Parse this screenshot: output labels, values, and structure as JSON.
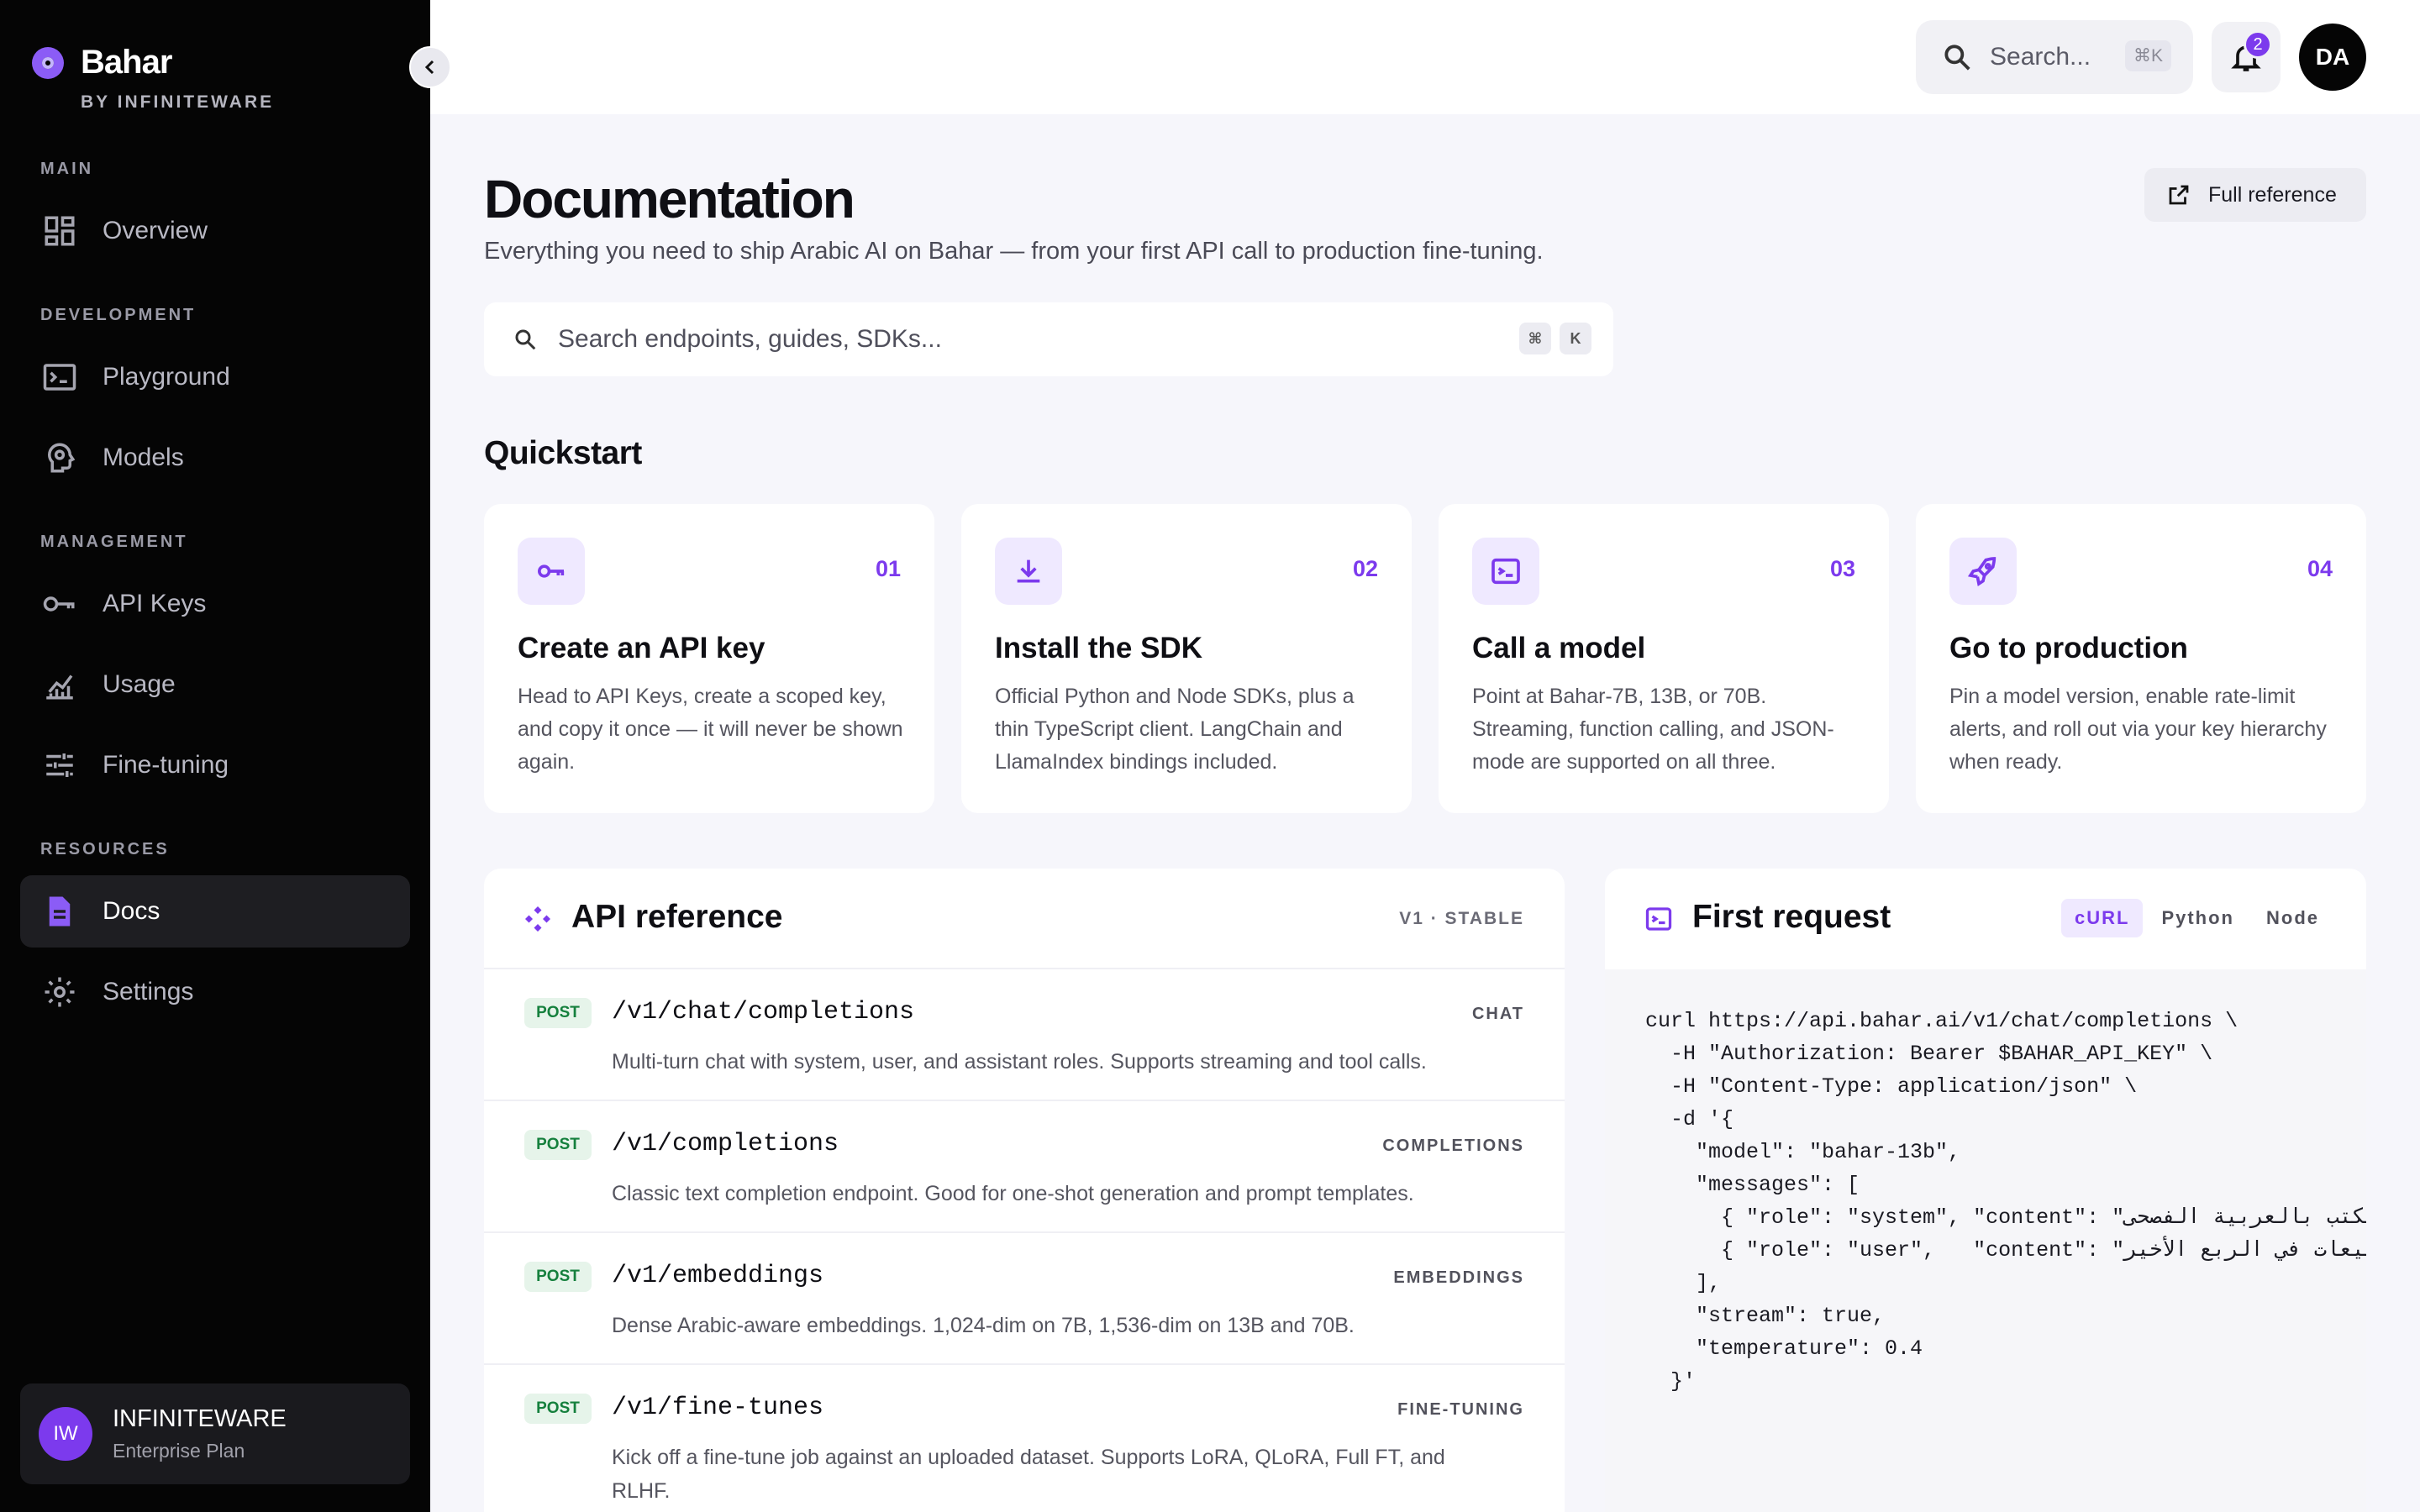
{
  "sidebar": {
    "brand_name": "Bahar",
    "brand_sub": "BY INFINITEWARE",
    "sections": {
      "main": "MAIN",
      "development": "DEVELOPMENT",
      "management": "MANAGEMENT",
      "resources": "RESOURCES"
    },
    "items": {
      "overview": "Overview",
      "playground": "Playground",
      "models": "Models",
      "api_keys": "API Keys",
      "usage": "Usage",
      "fine_tuning": "Fine-tuning",
      "docs": "Docs",
      "settings": "Settings"
    },
    "org": {
      "initials": "IW",
      "name": "INFINITEWARE",
      "plan": "Enterprise Plan"
    }
  },
  "topbar": {
    "search_placeholder": "Search...",
    "search_shortcut": "⌘K",
    "notification_count": "2",
    "user_initials": "DA"
  },
  "page": {
    "title": "Documentation",
    "subtitle": "Everything you need to ship Arabic AI on Bahar — from your first API call to production fine-tuning.",
    "full_reference": "Full reference",
    "search_placeholder": "Search endpoints, guides, SDKs...",
    "kbd_cmd": "⌘",
    "kbd_k": "K"
  },
  "quickstart": {
    "heading": "Quickstart",
    "steps": [
      {
        "num": "01",
        "title": "Create an API key",
        "desc": "Head to API Keys, create a scoped key, and copy it once — it will never be shown again."
      },
      {
        "num": "02",
        "title": "Install the SDK",
        "desc": "Official Python and Node SDKs, plus a thin TypeScript client. LangChain and LlamaIndex bindings included."
      },
      {
        "num": "03",
        "title": "Call a model",
        "desc": "Point at Bahar-7B, 13B, or 70B. Streaming, function calling, and JSON-mode are supported on all three."
      },
      {
        "num": "04",
        "title": "Go to production",
        "desc": "Pin a model version, enable rate-limit alerts, and roll out via your key hierarchy when ready."
      }
    ]
  },
  "api_reference": {
    "title": "API reference",
    "version": "V1 · STABLE",
    "endpoints": [
      {
        "method": "POST",
        "path": "/v1/chat/completions",
        "tag": "CHAT",
        "desc": "Multi-turn chat with system, user, and assistant roles. Supports streaming and tool calls."
      },
      {
        "method": "POST",
        "path": "/v1/completions",
        "tag": "COMPLETIONS",
        "desc": "Classic text completion endpoint. Good for one-shot generation and prompt templates."
      },
      {
        "method": "POST",
        "path": "/v1/embeddings",
        "tag": "EMBEDDINGS",
        "desc": "Dense Arabic-aware embeddings. 1,024-dim on 7B, 1,536-dim on 13B and 70B."
      },
      {
        "method": "POST",
        "path": "/v1/fine-tunes",
        "tag": "FINE-TUNING",
        "desc": "Kick off a fine-tune job against an uploaded dataset. Supports LoRA, QLoRA, Full FT, and RLHF."
      }
    ]
  },
  "first_request": {
    "title": "First request",
    "tabs": [
      "cURL",
      "Python",
      "Node"
    ],
    "active_tab": "cURL",
    "code": "curl https://api.bahar.ai/v1/chat/completions \\\n  -H \"Authorization: Bearer $BAHAR_API_KEY\" \\\n  -H \"Content-Type: application/json\" \\\n  -d '{\n    \"model\": \"bahar-13b\",\n    \"messages\": [\n      { \"role\": \"system\", \"content\": \"أنت مساعد رسمي يكتب بالعربية الفصحى\" },\n      { \"role\": \"user\",   \"content\": \"لخص أداء المبيعات في الربع الأخير\" }\n    ],\n    \"stream\": true,\n    \"temperature\": 0.4\n  }'"
  },
  "colors": {
    "accent": "#7c3aed",
    "sidebar_bg": "#050505",
    "method_post": "#15803d"
  }
}
